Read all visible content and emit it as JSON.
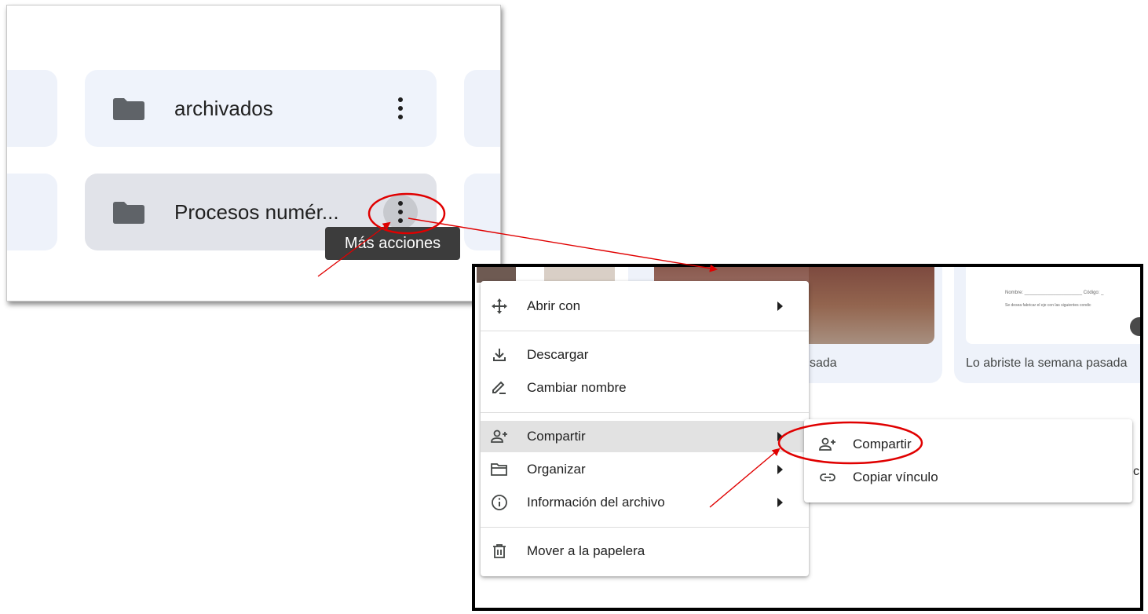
{
  "folders_panel": {
    "items": [
      {
        "name": "archivados"
      },
      {
        "name": "Procesos numér..."
      }
    ],
    "tooltip": "Más acciones"
  },
  "background": {
    "card_caption_left": "sada",
    "card_caption_right": "Lo abriste la semana pasada",
    "doc_preview": {
      "line1": "Nombre: ______________________ Código: _",
      "line2": "Se desea fabricar el eje con las siguientes condic"
    },
    "edge_letter": "c"
  },
  "context_menu": {
    "items": [
      {
        "label": "Abrir con",
        "icon": "open-with-icon",
        "has_submenu": true
      },
      {
        "label": "Descargar",
        "icon": "download-icon",
        "has_submenu": false
      },
      {
        "label": "Cambiar nombre",
        "icon": "rename-icon",
        "has_submenu": false
      },
      {
        "label": "Compartir",
        "icon": "share-person-add-icon",
        "has_submenu": true,
        "active": true
      },
      {
        "label": "Organizar",
        "icon": "folder-open-icon",
        "has_submenu": true
      },
      {
        "label": "Información del archivo",
        "icon": "info-icon",
        "has_submenu": true
      },
      {
        "label": "Mover a la papelera",
        "icon": "trash-icon",
        "has_submenu": false
      }
    ],
    "submenu": [
      {
        "label": "Compartir",
        "icon": "share-person-add-icon"
      },
      {
        "label": "Copiar vínculo",
        "icon": "link-icon"
      }
    ]
  },
  "colors": {
    "annotation": "#e00000",
    "folder_card": "#eff3fb",
    "hover_card": "#e1e3e9",
    "menu_active": "#e2e2e2",
    "tooltip_bg": "#3c3c3c"
  }
}
